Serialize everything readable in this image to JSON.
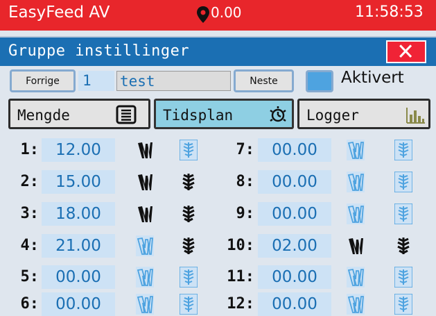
{
  "statusbar": {
    "app_title": "EasyFeed AV",
    "location_value": "0.00",
    "clock": "11:58:53",
    "bg_color": "#e8262b"
  },
  "titlebar": {
    "title": "Gruppe instillinger",
    "close_symbol": "X",
    "bg_color": "#1b6fb3"
  },
  "controls": {
    "prev_label": "Forrige",
    "group_number": "1",
    "group_name": "test",
    "next_label": "Neste",
    "active_label": "Aktivert",
    "active_checked": false
  },
  "tabs": [
    {
      "label": "Mengde",
      "icon": "list-icon",
      "active": false
    },
    {
      "label": "Tidsplan",
      "icon": "timer-icon",
      "active": true
    },
    {
      "label": "Logger",
      "icon": "bar-chart-icon",
      "active": false
    }
  ],
  "schedule": [
    {
      "index": "1:",
      "time": "12.00",
      "feed_on": true,
      "sprout_on": false
    },
    {
      "index": "2:",
      "time": "15.00",
      "feed_on": true,
      "sprout_on": true
    },
    {
      "index": "3:",
      "time": "18.00",
      "feed_on": true,
      "sprout_on": true
    },
    {
      "index": "4:",
      "time": "21.00",
      "feed_on": false,
      "sprout_on": true
    },
    {
      "index": "5:",
      "time": "00.00",
      "feed_on": false,
      "sprout_on": false
    },
    {
      "index": "6:",
      "time": "00.00",
      "feed_on": false,
      "sprout_on": false
    },
    {
      "index": "7:",
      "time": "00.00",
      "feed_on": false,
      "sprout_on": false
    },
    {
      "index": "8:",
      "time": "00.00",
      "feed_on": false,
      "sprout_on": false
    },
    {
      "index": "9:",
      "time": "00.00",
      "feed_on": false,
      "sprout_on": false
    },
    {
      "index": "10:",
      "time": "02.00",
      "feed_on": true,
      "sprout_on": true
    },
    {
      "index": "11:",
      "time": "00.00",
      "feed_on": false,
      "sprout_on": false
    },
    {
      "index": "12:",
      "time": "00.00",
      "feed_on": false,
      "sprout_on": false
    }
  ]
}
